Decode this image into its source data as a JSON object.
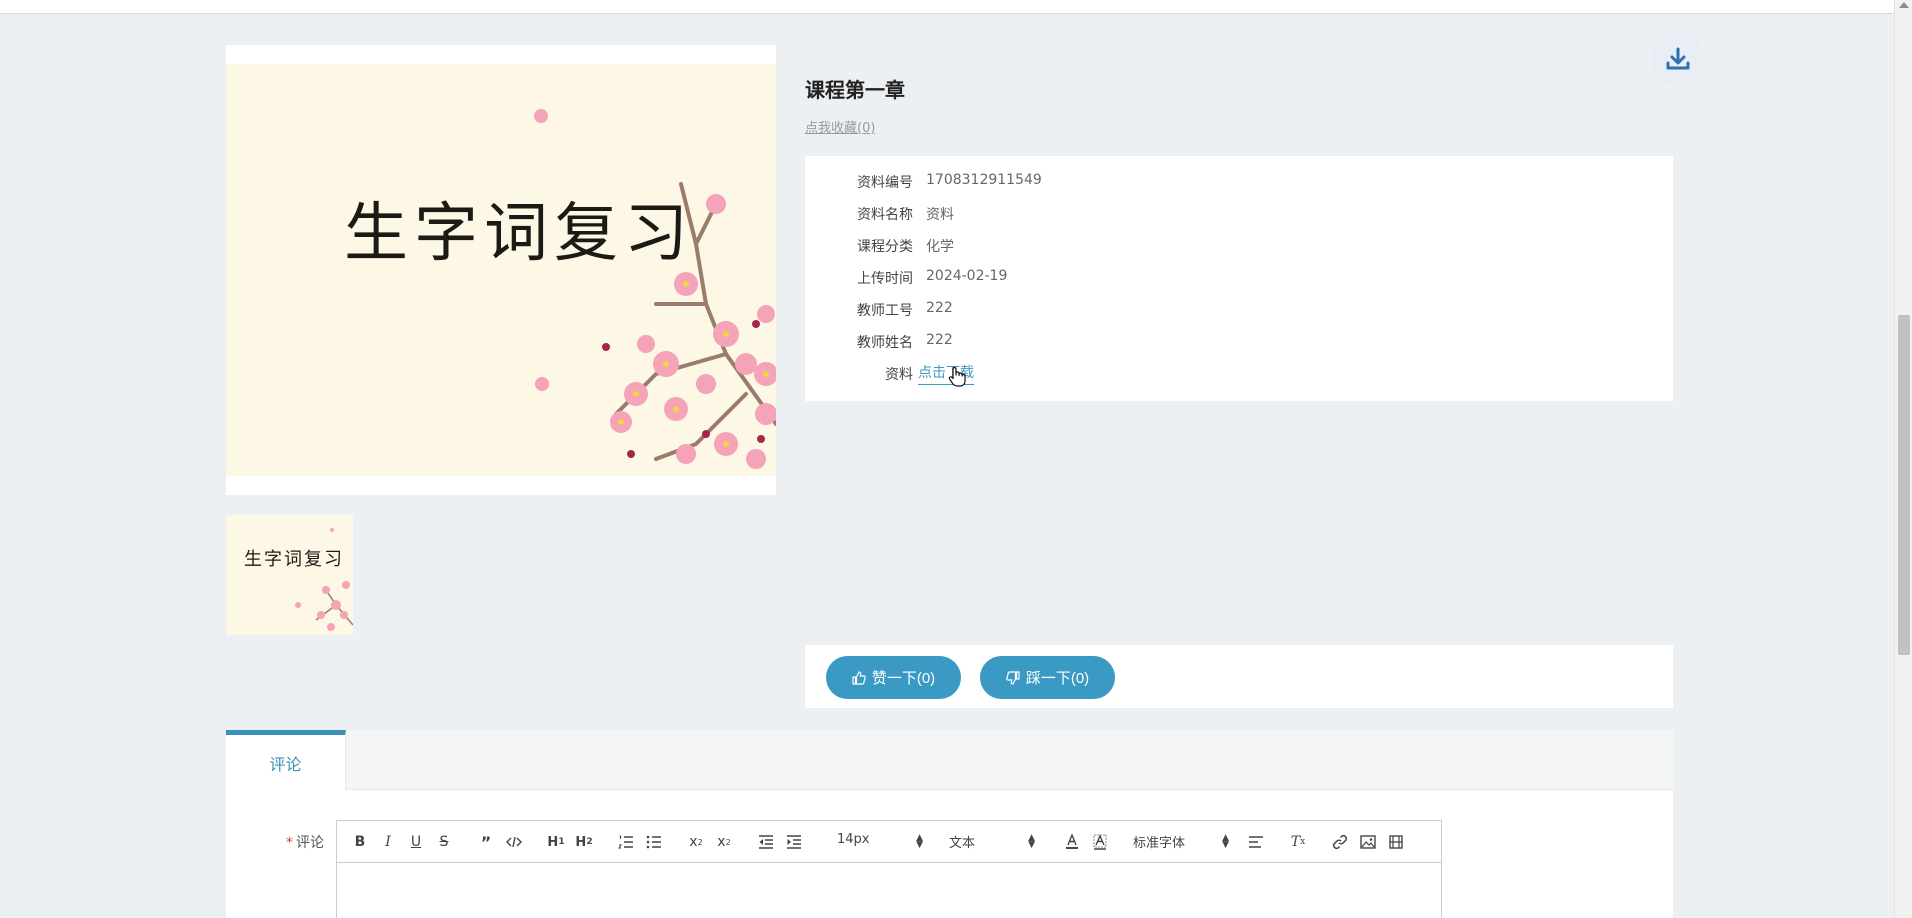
{
  "course": {
    "title": "课程第一章",
    "favorite_label": "点我收藏(0)"
  },
  "slide": {
    "title": "生字词复习"
  },
  "details": [
    {
      "key": "资料编号",
      "value": "1708312911549"
    },
    {
      "key": "资料名称",
      "value": "资料"
    },
    {
      "key": "课程分类",
      "value": "化学"
    },
    {
      "key": "上传时间",
      "value": "2024-02-19"
    },
    {
      "key": "教师工号",
      "value": "222"
    },
    {
      "key": "教师姓名",
      "value": "222"
    }
  ],
  "file": {
    "key": "资料",
    "link_label": "点击下载"
  },
  "votes": {
    "like_label": "赞一下(0)",
    "dislike_label": "踩一下(0)"
  },
  "comments": {
    "tab_label": "评论",
    "field_label": "评论",
    "required_mark": "*"
  },
  "editor": {
    "font_size": "14px",
    "block_type": "文本",
    "font_family": "标准字体"
  },
  "colors": {
    "accent": "#3a9ac4",
    "page_bg": "#edf0f2"
  }
}
